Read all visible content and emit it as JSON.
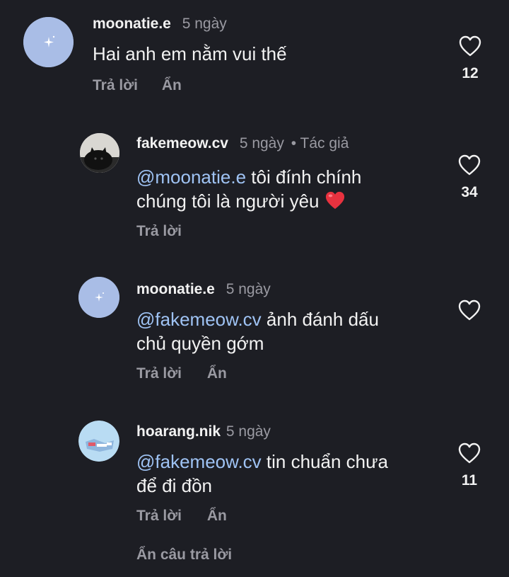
{
  "comments": [
    {
      "username": "moonatie.e",
      "time": "5 ngày",
      "author_tag": "",
      "mention": "",
      "text_line1": "Hai anh em nằm vui thế",
      "text_line2": "",
      "reply_label": "Trả lời",
      "hide_label": "Ẩn",
      "likes": "12",
      "avatar": "blue-sparkle"
    },
    {
      "username": "fakemeow.cv",
      "time": "5 ngày",
      "author_tag": "• Tác giả",
      "mention": "@moonatie.e",
      "text_line1": " tôi đính chính",
      "text_line2": "chúng tôi là người yêu",
      "reply_label": "Trả lời",
      "hide_label": "",
      "likes": "34",
      "avatar": "black-cat"
    },
    {
      "username": "moonatie.e",
      "time": "5 ngày",
      "author_tag": "",
      "mention": "@fakemeow.cv",
      "text_line1": " ảnh đánh dấu",
      "text_line2": "chủ quyền gớm",
      "reply_label": "Trả lời",
      "hide_label": "Ẩn",
      "likes": "",
      "avatar": "blue-sparkle"
    },
    {
      "username": "hoarang.nik",
      "time": "5 ngày",
      "author_tag": "",
      "mention": "@fakemeow.cv",
      "text_line1": " tin chuẩn chưa",
      "text_line2": "để đi đồn",
      "reply_label": "Trả lời",
      "hide_label": "Ẩn",
      "likes": "11",
      "avatar": "light-blue-sticker"
    }
  ],
  "collapse_label": "Ẩn câu trả lời",
  "colors": {
    "background": "#1d1e24",
    "mention": "#9fc3f4",
    "muted": "#9a9aa2",
    "avatar_blue": "#a9bde6"
  }
}
